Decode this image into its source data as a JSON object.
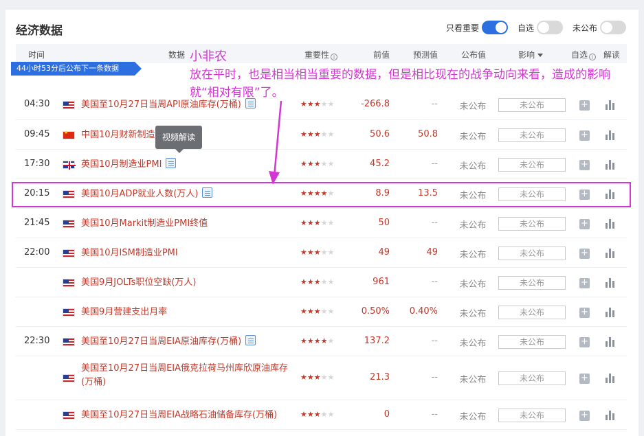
{
  "page": {
    "title": "经济数据"
  },
  "toggles": [
    {
      "label": "只看重要",
      "on": true
    },
    {
      "label": "自选",
      "on": false
    },
    {
      "label": "未公布",
      "on": false
    }
  ],
  "columns": {
    "time": "时间",
    "data": "数据",
    "importance": "重要性",
    "previous": "前值",
    "forecast": "预测值",
    "published": "公布值",
    "impact": "影响",
    "watch": "自选",
    "analysis": "解读"
  },
  "banner": "44小时53分后公布下一条数据",
  "annotation": {
    "title": "小非农",
    "text": "放在平时，也是相当相当重要的数据，但是相比现在的战争动向来看，造成的影响就“相对有限”了。"
  },
  "tooltip": "视频解读",
  "rows": [
    {
      "time": "04:30",
      "flag": "us",
      "name": "美国至10月27日当周API原油库存(万桶)",
      "doc": true,
      "stars": 3,
      "previous": "-266.8",
      "forecast": "--",
      "published": "未公布",
      "impact": "未公布"
    },
    {
      "time": "09:45",
      "flag": "cn",
      "name": "中国10月财新制造业PMI",
      "doc": true,
      "stars": 3,
      "previous": "50.6",
      "forecast": "50.8",
      "published": "未公布",
      "impact": "未公布"
    },
    {
      "time": "17:30",
      "flag": "uk",
      "name": "英国10月制造业PMI",
      "doc": true,
      "stars": 3,
      "previous": "45.2",
      "forecast": "--",
      "published": "未公布",
      "impact": "未公布"
    },
    {
      "time": "20:15",
      "flag": "us",
      "name": "美国10月ADP就业人数(万人)",
      "doc": true,
      "stars": 4,
      "previous": "8.9",
      "forecast": "13.5",
      "published": "未公布",
      "impact": "未公布"
    },
    {
      "time": "21:45",
      "flag": "us",
      "name": "美国10月Markit制造业PMI终值",
      "doc": false,
      "stars": 3,
      "previous": "50",
      "forecast": "--",
      "published": "未公布",
      "impact": "未公布"
    },
    {
      "time": "22:00",
      "flag": "us",
      "name": "美国10月ISM制造业PMI",
      "doc": false,
      "stars": 3,
      "previous": "49",
      "forecast": "49",
      "published": "未公布",
      "impact": "未公布"
    },
    {
      "time": "",
      "flag": "us",
      "name": "美国9月JOLTs职位空缺(万人)",
      "doc": false,
      "stars": 3,
      "previous": "961",
      "forecast": "--",
      "published": "未公布",
      "impact": "未公布"
    },
    {
      "time": "",
      "flag": "us",
      "name": "美国9月营建支出月率",
      "doc": false,
      "stars": 3,
      "previous": "0.50%",
      "forecast": "0.40%",
      "published": "未公布",
      "impact": "未公布"
    },
    {
      "time": "22:30",
      "flag": "us",
      "name": "美国至10月27日当周EIA原油库存(万桶)",
      "doc": true,
      "stars": 4,
      "previous": "137.2",
      "forecast": "--",
      "published": "未公布",
      "impact": "未公布"
    },
    {
      "time": "",
      "flag": "us",
      "name": "美国至10月27日当周EIA俄克拉荷马州库欣原油库存(万桶)",
      "doc": false,
      "stars": 3,
      "previous": "21.3",
      "forecast": "--",
      "published": "未公布",
      "impact": "未公布"
    },
    {
      "time": "",
      "flag": "us",
      "name": "美国至10月27日当周EIA战略石油储备库存(万桶)",
      "doc": false,
      "stars": 3,
      "previous": "0",
      "forecast": "--",
      "published": "未公布",
      "impact": "未公布"
    }
  ]
}
